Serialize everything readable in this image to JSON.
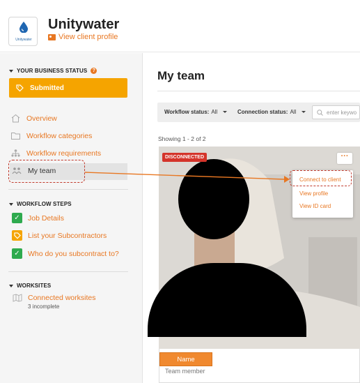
{
  "header": {
    "logo_text": "Unitywater",
    "client_name": "Unitywater",
    "view_profile": "View client profile"
  },
  "sidebar": {
    "business_status": {
      "title": "YOUR BUSINESS STATUS",
      "help_icon": "?",
      "status_label": "Submitted"
    },
    "nav": [
      {
        "label": "Overview",
        "icon": "home-icon"
      },
      {
        "label": "Workflow categories",
        "icon": "folder-icon"
      },
      {
        "label": "Workflow requirements",
        "icon": "hierarchy-icon"
      },
      {
        "label": "My team",
        "icon": "team-icon",
        "active": true
      }
    ],
    "workflow_steps": {
      "title": "WORKFLOW STEPS",
      "items": [
        {
          "label": "Job Details",
          "state": "complete"
        },
        {
          "label": "List your Subcontractors",
          "state": "in-progress"
        },
        {
          "label": "Who do you subcontract to?",
          "state": "complete"
        }
      ]
    },
    "worksites": {
      "title": "WORKSITES",
      "name": "Connected worksites",
      "sub": "3 incomplete"
    }
  },
  "main": {
    "title": "My team",
    "filters": {
      "workflow_label": "Workflow status:",
      "workflow_value": "All",
      "connection_label": "Connection status:",
      "connection_value": "All",
      "search_placeholder": "enter keywo"
    },
    "showing": "Showing 1 - 2 of 2",
    "card": {
      "badge": "DISCONNECTED",
      "more": "···",
      "menu": [
        "Connect to client",
        "View profile",
        "View ID card"
      ],
      "name": "Name",
      "role": "Team member"
    }
  },
  "colors": {
    "accent": "#e87722",
    "status_submitted": "#f5a400",
    "disconnected": "#d4342a",
    "check_green": "#2eaa4e",
    "annotation": "#c0392b"
  }
}
